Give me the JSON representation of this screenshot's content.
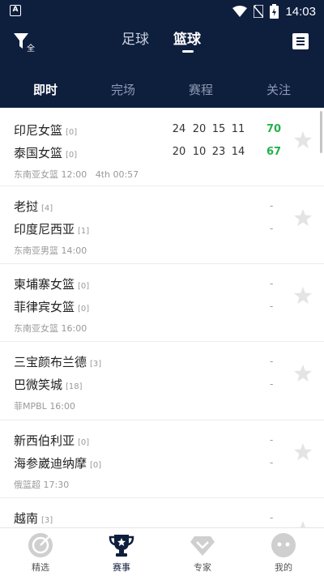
{
  "status_bar": {
    "time": "14:03",
    "app_letter": "A"
  },
  "top_nav": {
    "filter_label": "全",
    "sport_tabs": [
      {
        "label": "足球",
        "active": false
      },
      {
        "label": "篮球",
        "active": true
      }
    ]
  },
  "sub_tabs": [
    {
      "label": "即时",
      "active": true
    },
    {
      "label": "完场",
      "active": false
    },
    {
      "label": "赛程",
      "active": false
    },
    {
      "label": "关注",
      "active": false
    }
  ],
  "matches": [
    {
      "home": {
        "name": "印尼女篮",
        "rank": "[0]",
        "quarters": [
          "24",
          "20",
          "15",
          "11"
        ],
        "total": "70"
      },
      "away": {
        "name": "泰国女篮",
        "rank": "[0]",
        "quarters": [
          "20",
          "10",
          "23",
          "14"
        ],
        "total": "67"
      },
      "league": "东南亚女篮",
      "time": "12:00",
      "status": "4th 00:57"
    },
    {
      "home": {
        "name": "老挝",
        "rank": "[4]",
        "score": "-"
      },
      "away": {
        "name": "印度尼西亚",
        "rank": "[1]",
        "score": "-"
      },
      "league": "东南亚男篮",
      "time": "14:00"
    },
    {
      "home": {
        "name": "柬埔寨女篮",
        "rank": "[0]",
        "score": "-"
      },
      "away": {
        "name": "菲律宾女篮",
        "rank": "[0]",
        "score": "-"
      },
      "league": "东南亚女篮",
      "time": "16:00"
    },
    {
      "home": {
        "name": "三宝颜布兰德",
        "rank": "[3]",
        "score": "-"
      },
      "away": {
        "name": "巴微笑城",
        "rank": "[18]",
        "score": "-"
      },
      "league": "菲MPBL",
      "time": "16:00"
    },
    {
      "home": {
        "name": "新西伯利亚",
        "rank": "[0]",
        "score": "-"
      },
      "away": {
        "name": "海参崴迪纳摩",
        "rank": "[0]",
        "score": "-"
      },
      "league": "俄篮超",
      "time": "17:30"
    },
    {
      "home": {
        "name": "越南",
        "rank": "[3]",
        "score": "-"
      }
    }
  ],
  "bottom_nav": [
    {
      "label": "精选",
      "icon": "target-icon"
    },
    {
      "label": "赛事",
      "icon": "trophy-icon",
      "active": true
    },
    {
      "label": "专家",
      "icon": "diamond-icon"
    },
    {
      "label": "我的",
      "icon": "face-icon"
    }
  ],
  "colors": {
    "header_bg": "#0e1e3d",
    "score_green": "#21b24a",
    "icon_grey": "#c9c9c9"
  }
}
